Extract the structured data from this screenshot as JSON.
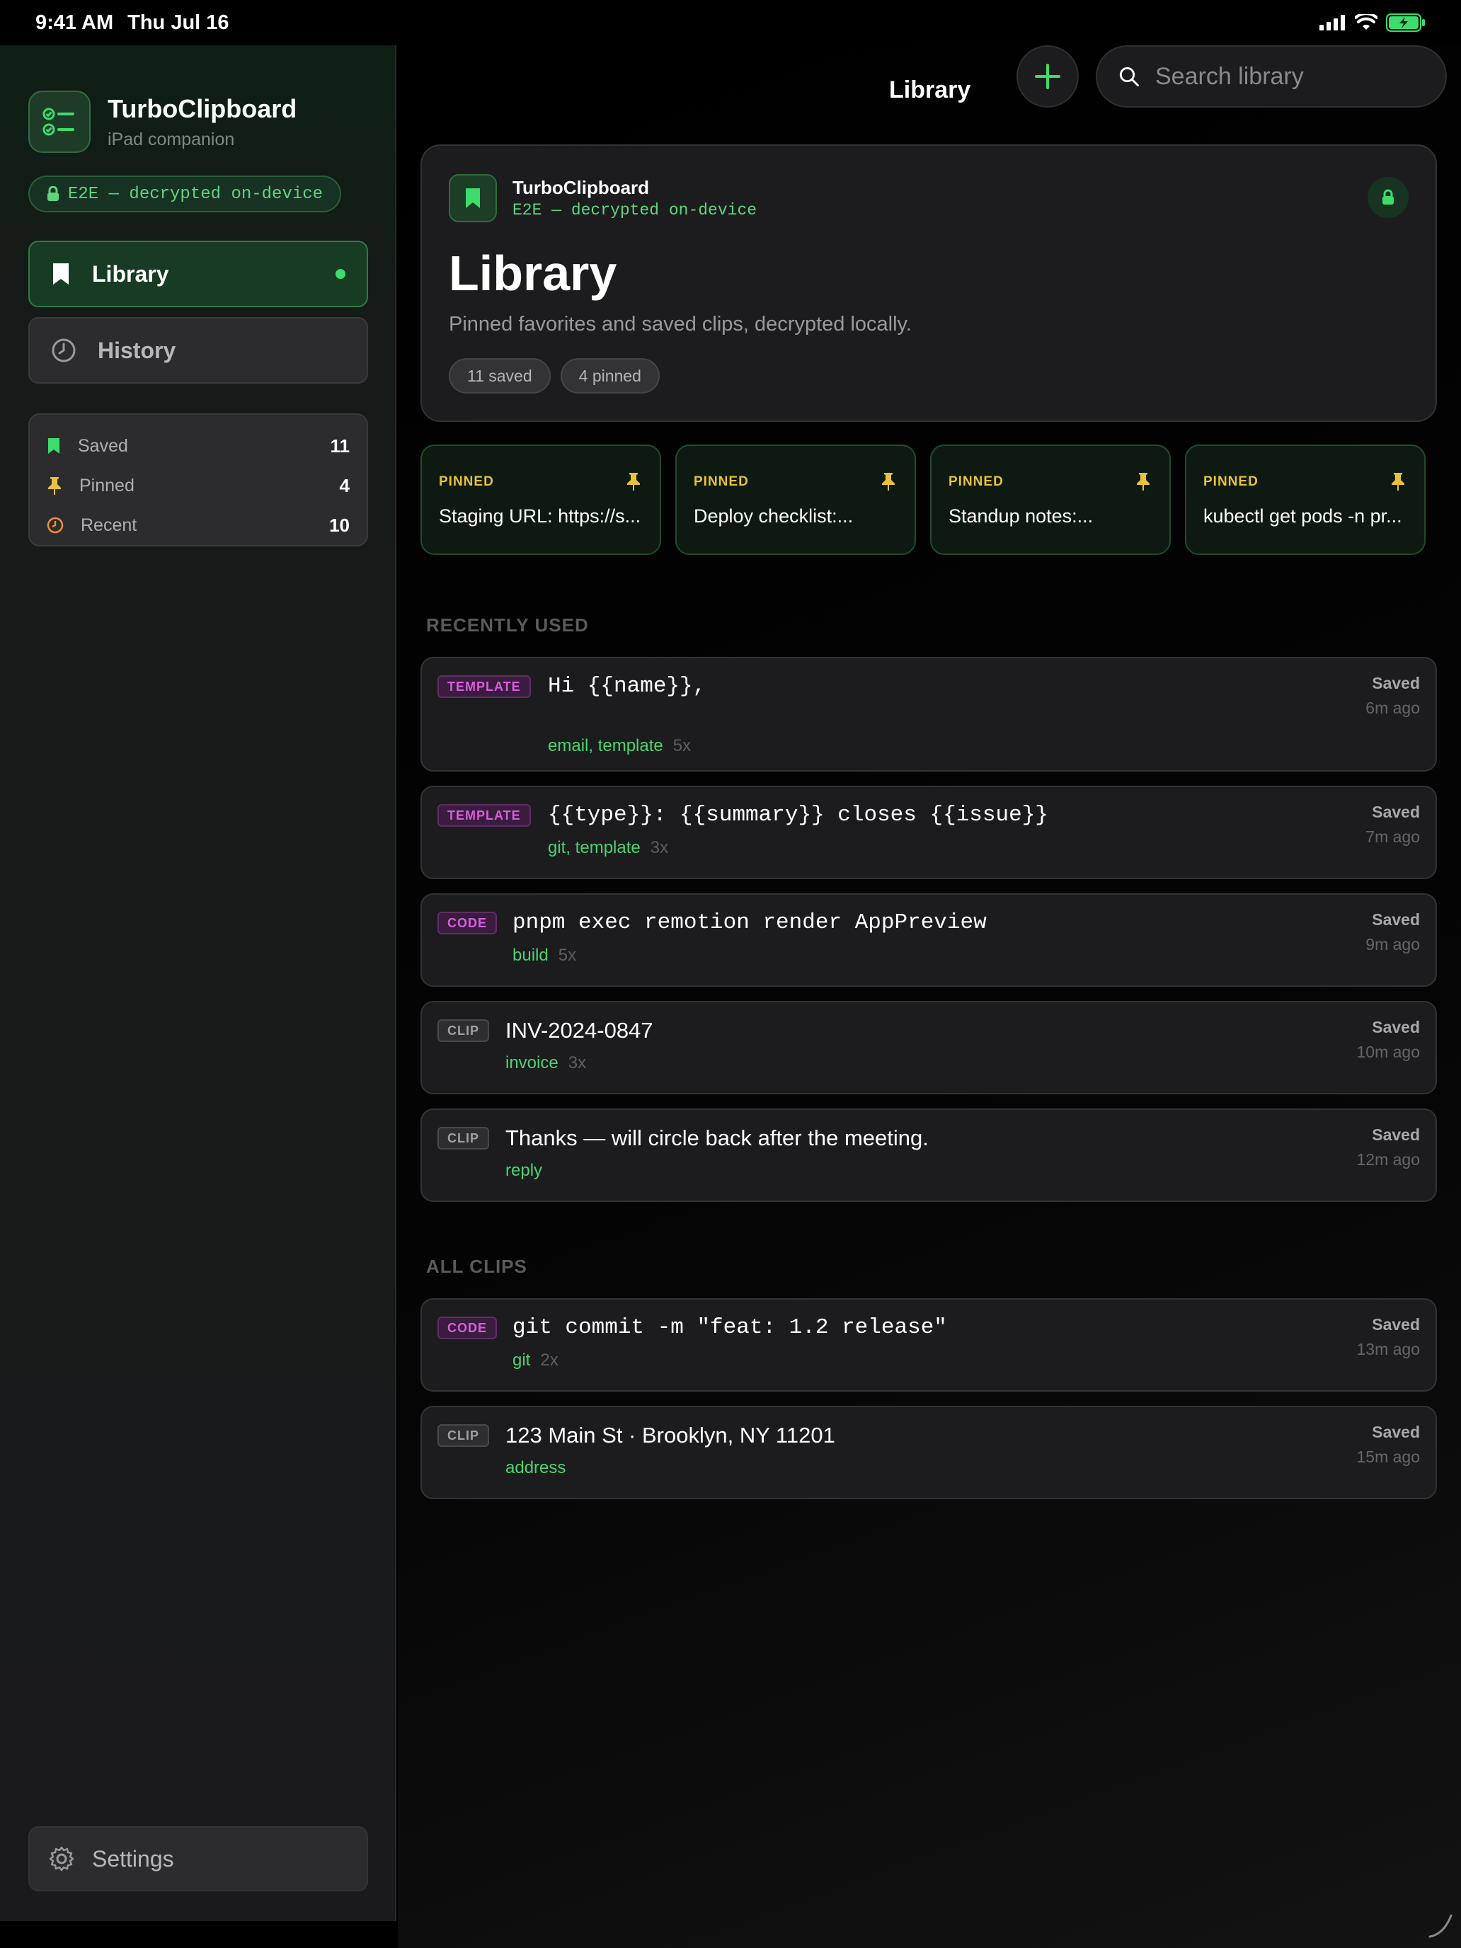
{
  "status_bar": {
    "time": "9:41 AM",
    "date": "Thu Jul 16"
  },
  "sidebar": {
    "app_name": "TurboClipboard",
    "app_sub": "iPad companion",
    "e2e": "E2E — decrypted on-device",
    "nav": [
      {
        "label": "Library",
        "icon": "bookmark-icon",
        "active": true
      },
      {
        "label": "History",
        "icon": "clock-icon",
        "active": false
      }
    ],
    "stats": [
      {
        "label": "Saved",
        "count": "11",
        "icon": "bookmark-icon",
        "color": "#3ddc6c"
      },
      {
        "label": "Pinned",
        "count": "4",
        "icon": "pin-icon",
        "color": "#e8c23a"
      },
      {
        "label": "Recent",
        "count": "10",
        "icon": "clock-icon",
        "color": "#f0902c"
      }
    ],
    "settings": "Settings"
  },
  "topbar": {
    "title": "Library",
    "search_placeholder": "Search library"
  },
  "hero": {
    "app": "TurboClipboard",
    "e2e": "E2E — decrypted on-device",
    "title": "Library",
    "description": "Pinned favorites and saved clips, decrypted locally.",
    "chips": [
      "11 saved",
      "4 pinned"
    ]
  },
  "pinned": [
    {
      "label": "PINNED",
      "text": "Staging URL: https://s..."
    },
    {
      "label": "PINNED",
      "text": "Deploy checklist:..."
    },
    {
      "label": "PINNED",
      "text": "Standup notes:..."
    },
    {
      "label": "PINNED",
      "text": "kubectl get pods -n pr..."
    }
  ],
  "sections": {
    "recent": "RECENTLY USED",
    "all": "ALL CLIPS"
  },
  "recent": [
    {
      "kind": "TEMPLATE",
      "text": "Hi {{name}},",
      "tags": "email, template",
      "uses": "5x",
      "status": "Saved",
      "ago": "6m ago"
    },
    {
      "kind": "TEMPLATE",
      "text": "{{type}}: {{summary}} closes {{issue}}",
      "tags": "git, template",
      "uses": "3x",
      "status": "Saved",
      "ago": "7m ago"
    },
    {
      "kind": "CODE",
      "text": "pnpm exec remotion render AppPreview",
      "tags": "build",
      "uses": "5x",
      "status": "Saved",
      "ago": "9m ago"
    },
    {
      "kind": "CLIP",
      "text": "INV-2024-0847",
      "tags": "invoice",
      "uses": "3x",
      "status": "Saved",
      "ago": "10m ago"
    },
    {
      "kind": "CLIP",
      "text": "Thanks — will circle back after the meeting.",
      "tags": "reply",
      "uses": "",
      "status": "Saved",
      "ago": "12m ago"
    }
  ],
  "all": [
    {
      "kind": "CODE",
      "text": "git commit -m \"feat: 1.2 release\"",
      "tags": "git",
      "uses": "2x",
      "status": "Saved",
      "ago": "13m ago"
    },
    {
      "kind": "CLIP",
      "text": "123 Main St · Brooklyn, NY 11201",
      "tags": "address",
      "uses": "",
      "status": "Saved",
      "ago": "15m ago"
    }
  ]
}
